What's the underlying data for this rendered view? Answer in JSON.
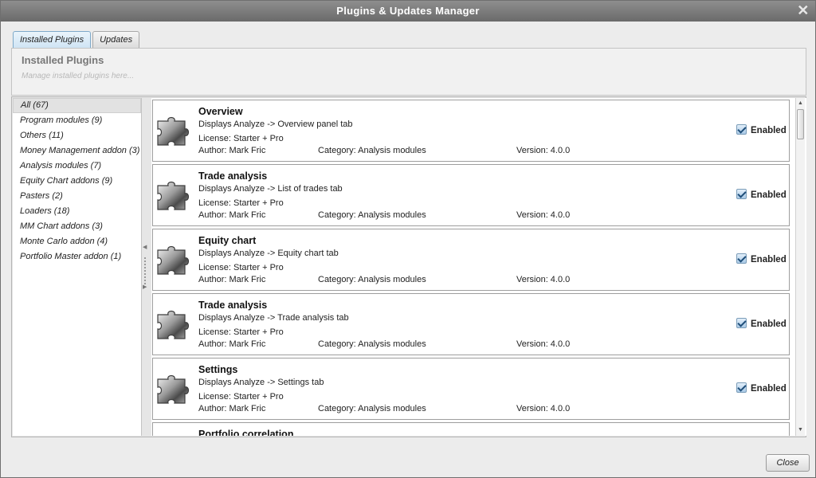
{
  "window": {
    "title": "Plugins & Updates Manager"
  },
  "tabs": [
    {
      "label": "Installed Plugins"
    },
    {
      "label": "Updates"
    }
  ],
  "header": {
    "title": "Installed Plugins",
    "placeholder": "Manage installed plugins here..."
  },
  "sidebar": {
    "items": [
      {
        "label": "All (67)"
      },
      {
        "label": "Program modules (9)"
      },
      {
        "label": "Others (11)"
      },
      {
        "label": "Money Management addon (3)"
      },
      {
        "label": "Analysis modules (7)"
      },
      {
        "label": "Equity Chart addons (9)"
      },
      {
        "label": "Pasters (2)"
      },
      {
        "label": "Loaders (18)"
      },
      {
        "label": "MM Chart addons (3)"
      },
      {
        "label": "Monte Carlo addon (4)"
      },
      {
        "label": "Portfolio Master addon (1)"
      }
    ]
  },
  "plugins": [
    {
      "name": "Overview",
      "desc": "Displays Analyze -> Overview panel tab",
      "license": "License:  Starter + Pro",
      "author": "Author:  Mark Fric",
      "category": "Category:  Analysis modules",
      "version": "Version:  4.0.0",
      "enabled_label": "Enabled"
    },
    {
      "name": "Trade analysis",
      "desc": "Displays Analyze -> List of trades tab",
      "license": "License:  Starter + Pro",
      "author": "Author:  Mark Fric",
      "category": "Category:  Analysis modules",
      "version": "Version:  4.0.0",
      "enabled_label": "Enabled"
    },
    {
      "name": "Equity chart",
      "desc": "Displays Analyze -> Equity chart tab",
      "license": "License:  Starter + Pro",
      "author": "Author:  Mark Fric",
      "category": "Category:  Analysis modules",
      "version": "Version:  4.0.0",
      "enabled_label": "Enabled"
    },
    {
      "name": "Trade analysis",
      "desc": "Displays Analyze -> Trade analysis tab",
      "license": "License:  Starter + Pro",
      "author": "Author:  Mark Fric",
      "category": "Category:  Analysis modules",
      "version": "Version:  4.0.0",
      "enabled_label": "Enabled"
    },
    {
      "name": "Settings",
      "desc": "Displays Analyze -> Settings tab",
      "license": "License:  Starter + Pro",
      "author": "Author:  Mark Fric",
      "category": "Category:  Analysis modules",
      "version": "Version:  4.0.0",
      "enabled_label": "Enabled"
    },
    {
      "name": "Portfolio correlation"
    }
  ],
  "footer": {
    "close_label": "Close"
  },
  "icons": {
    "close": "close-icon",
    "plugin": "puzzle-piece-icon",
    "collapse": "chevron-left-icon",
    "expand": "chevron-right-icon"
  }
}
